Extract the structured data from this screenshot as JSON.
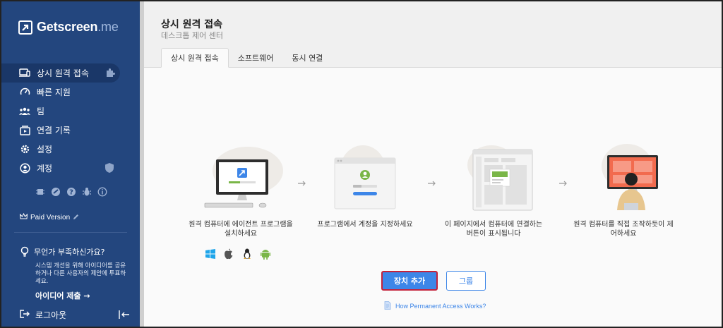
{
  "brand": {
    "name_main": "Getscreen",
    "name_suffix": ".me"
  },
  "sidebar": {
    "items": [
      {
        "label": "상시 원격 접속",
        "icon": "devices-icon",
        "active": true
      },
      {
        "label": "빠른 지원",
        "icon": "speedometer-icon"
      },
      {
        "label": "팀",
        "icon": "team-icon"
      },
      {
        "label": "연결 기록",
        "icon": "history-icon"
      },
      {
        "label": "설정",
        "icon": "gear-icon"
      },
      {
        "label": "계정",
        "icon": "user-circle-icon"
      }
    ],
    "paid_version": "Paid Version",
    "idea": {
      "title": "무언가 부족하신가요?",
      "body": "시스템 개선을 위해 아이디어를 공유하거나 다른 사용자의 제안에 투표하세요.",
      "link": "아이디어 제출 →"
    },
    "logout": "로그아웃"
  },
  "header": {
    "title": "상시 원격 접속",
    "subtitle": "데스크톱 제어 센터",
    "tabs": [
      "상시 원격 접속",
      "소프트웨어",
      "동시 연결"
    ]
  },
  "steps": [
    {
      "caption": "원격 컴퓨터에 에이전트 프로그램을 설치하세요"
    },
    {
      "caption": "프로그램에서 계정을 지정하세요"
    },
    {
      "caption": "이 페이지에서 컴퓨터에 연결하는 버튼이 표시됩니다"
    },
    {
      "caption": "원격 컴퓨터를 직접 조작하듯이 제어하세요"
    }
  ],
  "buttons": {
    "add_device": "장치 추가",
    "group": "그룹"
  },
  "help_link": "How Permanent Access Works?",
  "colors": {
    "sidebar": "#23467e",
    "accent": "#3d86e8",
    "highlight": "#c4223b"
  }
}
